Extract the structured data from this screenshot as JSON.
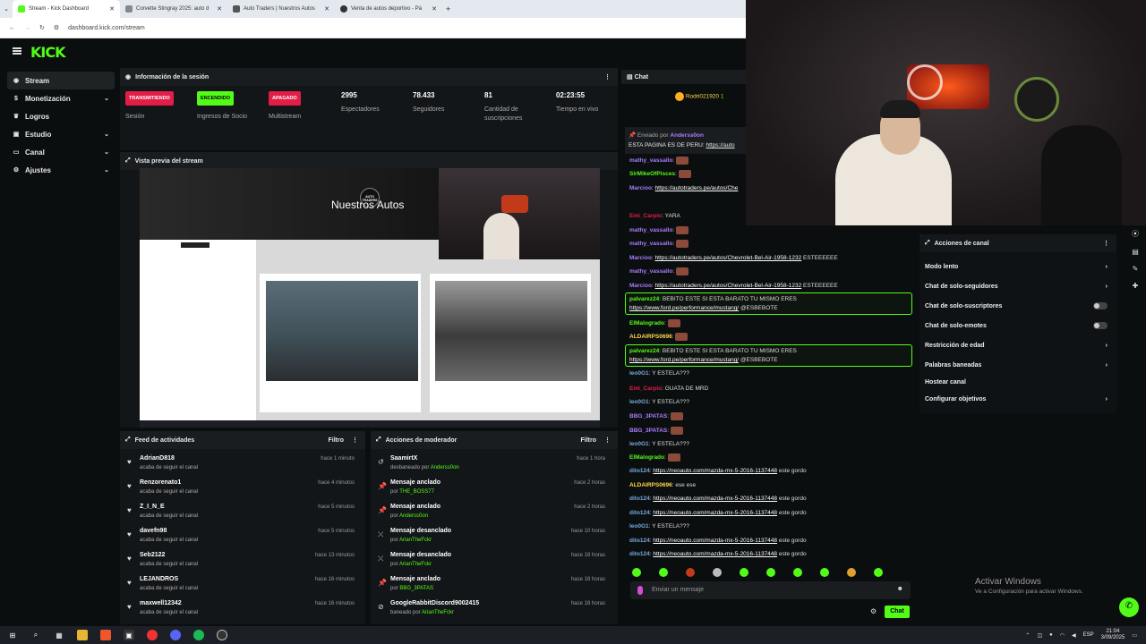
{
  "browser": {
    "tabs": [
      {
        "label": "Stream - Kick Dashboard",
        "active": true
      },
      {
        "label": "Corvette Stingray 2025: auto d"
      },
      {
        "label": "Auto Traders | Nuestros Autos"
      },
      {
        "label": "Venta de autos deportivo - Pá"
      }
    ],
    "url": "dashboard.kick.com/stream"
  },
  "kick": {
    "logo": "KICK"
  },
  "sidebar": [
    {
      "label": "Stream",
      "icon": "broadcast-icon"
    },
    {
      "label": "Monetización",
      "icon": "dollar-icon"
    },
    {
      "label": "Logros",
      "icon": "trophy-icon"
    },
    {
      "label": "Estudio",
      "icon": "studio-icon"
    },
    {
      "label": "Canal",
      "icon": "channel-icon"
    },
    {
      "label": "Ajustes",
      "icon": "gear-icon"
    }
  ],
  "session": {
    "title": "Información de la sesión",
    "stats": [
      {
        "badge": "TRANSMITIENDO",
        "color": "#e11d48",
        "label": "Sesión"
      },
      {
        "badge": "ENCENDIDO",
        "color": "#53fc18",
        "label": "Ingresos de Socio"
      },
      {
        "badge": "APAGADO",
        "color": "#e11d48",
        "label": "Multistream"
      },
      {
        "value": "2995",
        "label": "Espectadores"
      },
      {
        "value": "78.433",
        "label": "Seguidores"
      },
      {
        "value": "81",
        "label": "Cantidad de suscripciones"
      },
      {
        "value": "02:23:55",
        "label": "Tiempo en vivo"
      }
    ]
  },
  "preview": {
    "title": "Vista previa del stream",
    "site_heading": "Nuestros Autos",
    "logo": "AUTO TRADERS"
  },
  "feed": {
    "title": "Feed de actividades",
    "filter": "Filtro",
    "items": [
      {
        "name": "AdrianD818",
        "sub": "acaba de seguir el canal",
        "time": "hace 1 minuto"
      },
      {
        "name": "Renzorenato1",
        "sub": "acaba de seguir el canal",
        "time": "hace 4 minutos"
      },
      {
        "name": "Z_I_N_E",
        "sub": "acaba de seguir el canal",
        "time": "hace 5 minutos"
      },
      {
        "name": "davefn98",
        "sub": "acaba de seguir el canal",
        "time": "hace 5 minutos"
      },
      {
        "name": "Seb2122",
        "sub": "acaba de seguir el canal",
        "time": "hace 13 minutos"
      },
      {
        "name": "LEJANDROS",
        "sub": "acaba de seguir el canal",
        "time": "hace 16 minutos"
      },
      {
        "name": "maxwell12342",
        "sub": "acaba de seguir el canal",
        "time": "hace 16 minutos"
      }
    ]
  },
  "mod": {
    "title": "Acciones de moderador",
    "filter": "Filtro",
    "items": [
      {
        "name": "SaamirtX",
        "sub": "desbaneado por",
        "by": "Anderss0on",
        "time": "hace 1 hora"
      },
      {
        "name": "Mensaje anclado",
        "sub": "por",
        "by": "THE_BOSS77",
        "time": "hace 2 horas"
      },
      {
        "name": "Mensaje anclado",
        "sub": "por",
        "by": "Anderss0on",
        "time": "hace 2 horas"
      },
      {
        "name": "Mensaje desanclado",
        "sub": "por",
        "by": "ArianTheFckr",
        "time": "hace 10 horas"
      },
      {
        "name": "Mensaje desanclado",
        "sub": "por",
        "by": "ArianTheFckr",
        "time": "hace 18 horas"
      },
      {
        "name": "Mensaje anclado",
        "sub": "por",
        "by": "BBG_3PATAS",
        "time": "hace 18 horas"
      },
      {
        "name": "GoogleRabbitDiscord9002415",
        "sub": "baneado por",
        "by": "ArianTheFckr",
        "time": "hace 18 horas"
      }
    ]
  },
  "chat": {
    "title": "Chat",
    "top_user": "Rodri021920",
    "top_count": "1",
    "pinned_label": "Enviado por",
    "pinned_user": "Anderss0on",
    "pinned_text": "ESTA PAGINA ES DE PERU",
    "pinned_link": "https://auto",
    "messages": [
      {
        "user": "mathy_vassallo",
        "color": "#a97cff",
        "text": "",
        "emote": true
      },
      {
        "user": "SirMikeOfPisces",
        "color": "#53fc18",
        "text": "",
        "emote": true
      },
      {
        "user": "Marcioo",
        "color": "#a97cff",
        "link": "https://autotraders.pe/autos/Che"
      },
      {
        "user": "Emi_Carpio",
        "color": "#e11d48",
        "text": "YARA"
      },
      {
        "user": "mathy_vassallo",
        "color": "#a97cff",
        "text": "",
        "emote": true
      },
      {
        "user": "mathy_vassallo",
        "color": "#a97cff",
        "text": "",
        "emote": true
      },
      {
        "user": "Marcioo",
        "color": "#a97cff",
        "link": "https://autotraders.pe/autos/Chevrolet-Bel-Air-1958-1232",
        "text": "ESTEEEEEE"
      },
      {
        "user": "mathy_vassallo",
        "color": "#a97cff",
        "text": "",
        "emote": true
      },
      {
        "user": "Marcioo",
        "color": "#a97cff",
        "link": "https://autotraders.pe/autos/Chevrolet-Bel-Air-1958-1232",
        "text": "ESTEEEEEE"
      },
      {
        "user": "palvarez24",
        "color": "#53fc18",
        "text": "BEBITO ESTE SI ESTA BARATO TU MISMO ERES",
        "link2": "https://www.ford.pe/performance/mustang/",
        "text2": "@ESBEBOTE",
        "highlight": true
      },
      {
        "user": "ElMalogrado",
        "color": "#53fc18",
        "text": "",
        "emote": true
      },
      {
        "user": "ALDAIRPS0696",
        "color": "#ffd84d",
        "text": "",
        "emote": true
      },
      {
        "user": "palvarez24",
        "color": "#53fc18",
        "text": "BEBITO ESTE SI ESTA BARATO TU MISMO ERES",
        "link2": "https://www.ford.pe/performance/mustang/",
        "text2": "@ESBEBOTE",
        "highlight": true
      },
      {
        "user": "leo0G1",
        "color": "#7ad",
        "text": "Y ESTELA???"
      },
      {
        "user": "Emi_Carpio",
        "color": "#e11d48",
        "text": "GUATA DE MRD"
      },
      {
        "user": "leo0G1",
        "color": "#7ad",
        "text": "Y ESTELA???"
      },
      {
        "user": "BBG_3PATAS",
        "color": "#a97cff",
        "text": "",
        "emote": true
      },
      {
        "user": "BBG_3PATAS",
        "color": "#a97cff",
        "text": "",
        "emote": true
      },
      {
        "user": "leo0G1",
        "color": "#7ad",
        "text": "Y ESTELA???"
      },
      {
        "user": "ElMalogrado",
        "color": "#53fc18",
        "text": "",
        "emote": true
      },
      {
        "user": "dito124",
        "color": "#7ad",
        "link": "https://neoauto.com/mazda-mx-5-2016-1137448",
        "text": "este gordo"
      },
      {
        "user": "ALDAIRPS0696",
        "color": "#ffd84d",
        "text": "ese ese"
      },
      {
        "user": "dito124",
        "color": "#7ad",
        "link": "https://neoauto.com/mazda-mx-5-2016-1137448",
        "text": "este gordo"
      },
      {
        "user": "dito124",
        "color": "#7ad",
        "link": "https://neoauto.com/mazda-mx-5-2016-1137448",
        "text": "este gordo"
      },
      {
        "user": "leo0G1",
        "color": "#7ad",
        "text": "Y ESTELA???"
      },
      {
        "user": "dito124",
        "color": "#7ad",
        "link": "https://neoauto.com/mazda-mx-5-2016-1137448",
        "text": "este gordo"
      },
      {
        "user": "dito124",
        "color": "#7ad",
        "link": "https://neoauto.com/mazda-mx-5-2016-1137448",
        "text": "este gordo"
      }
    ],
    "input_placeholder": "Enviar un mensaje",
    "send_label": "Chat"
  },
  "channel_actions": {
    "title": "Acciones de canal",
    "items": [
      {
        "label": "Modo lento",
        "type": "chevron"
      },
      {
        "label": "Chat de solo-seguidores",
        "type": "chevron"
      },
      {
        "label": "Chat de solo-suscriptores",
        "type": "toggle"
      },
      {
        "label": "Chat de solo-emotes",
        "type": "toggle"
      },
      {
        "label": "Restricción de edad",
        "type": "chevron"
      },
      {
        "label": "Palabras baneadas",
        "type": "chevron"
      },
      {
        "label": "Hostear canal",
        "type": "none"
      },
      {
        "label": "Configurar objetivos",
        "type": "chevron"
      }
    ]
  },
  "watermark": {
    "title": "Activar Windows",
    "sub": "Ve a Configuración para activar Windows."
  },
  "taskbar": {
    "lang": "ESP",
    "time": "21:04",
    "date": "3/09/2025"
  }
}
